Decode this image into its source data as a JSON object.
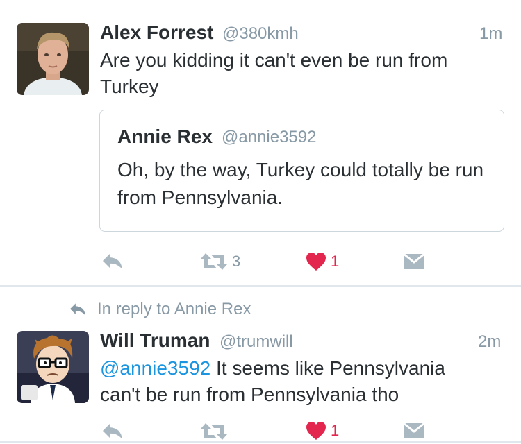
{
  "tweet1": {
    "name": "Alex Forrest",
    "handle": "@380kmh",
    "time": "1m",
    "text_line1": "Are you kidding it can't even be run from",
    "text_line2": "Turkey",
    "quote": {
      "name": "Annie Rex",
      "handle": "@annie3592",
      "text": "Oh, by the way, Turkey could totally be run from Pennsylvania."
    },
    "actions": {
      "retweet_count": "3",
      "like_count": "1"
    }
  },
  "tweet2": {
    "reply_context": "In reply to Annie Rex",
    "name": "Will Truman",
    "handle": "@trumwill",
    "time": "2m",
    "mention": "@annie3592",
    "text_rest": " It seems like Pennsylvania",
    "text_line2": "can't be run from Pennsylvania tho",
    "actions": {
      "like_count": "1"
    }
  },
  "colors": {
    "like_red": "#e2264d",
    "link_blue": "#1b95e0",
    "gray": "#8899a6",
    "icon_gray": "#aab8c2"
  },
  "icons": [
    "reply-icon",
    "retweet-icon",
    "heart-icon",
    "direct-message-icon"
  ]
}
